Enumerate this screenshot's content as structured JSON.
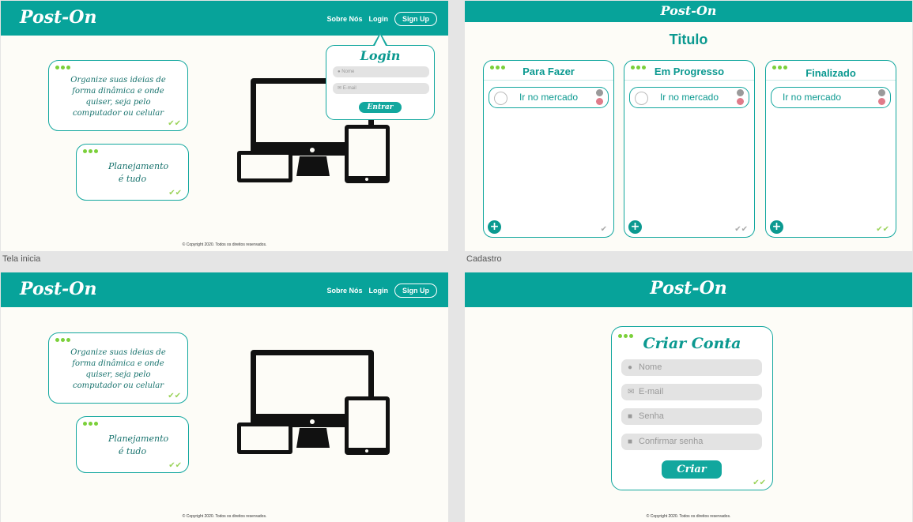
{
  "brand": "Post-On",
  "nav": {
    "about": "Sobre Nós",
    "login": "Login",
    "signup": "Sign Up"
  },
  "cards": {
    "card1": "Organize suas ideias de forma dinâmica e onde quiser, seja pelo computador ou celular",
    "card2": "Planejamento é tudo"
  },
  "copyright": "© Copyright 2020. Todos os direitos reservados.",
  "frame_labels": {
    "home": "Tela inicia",
    "signup": "Cadastro"
  },
  "login_popup": {
    "title": "Login",
    "name_placeholder": "Nome",
    "email_placeholder": "E-mail",
    "submit": "Entrar"
  },
  "board": {
    "title": "Titulo",
    "columns": [
      {
        "title": "Para Fazer",
        "task": "Ir no mercado"
      },
      {
        "title": "Em Progresso",
        "task": "Ir no mercado"
      },
      {
        "title": "Finalizado",
        "task": "Ir no mercado"
      }
    ]
  },
  "create": {
    "title": "Criar Conta",
    "name": "Nome",
    "email": "E-mail",
    "password": "Senha",
    "confirm": "Confirmar senha",
    "submit": "Criar"
  },
  "colors": {
    "teal": "#07a39a",
    "dot_green": "#7bd03a",
    "check": "#9bd35a"
  },
  "icons": [
    "dots-icon",
    "check-icon",
    "user-icon",
    "mail-icon",
    "lock-icon",
    "plus-icon"
  ]
}
